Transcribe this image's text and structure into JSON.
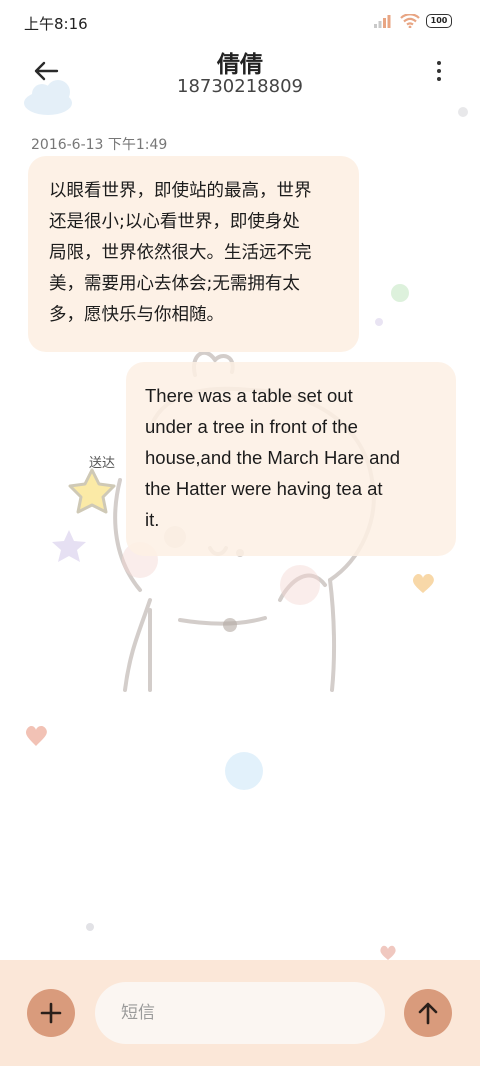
{
  "status_bar": {
    "time": "上午8:16",
    "battery": "100",
    "icons": [
      "signal-icon",
      "wifi-icon",
      "battery-icon"
    ]
  },
  "header": {
    "title": "倩倩",
    "phone": "18730218809",
    "icons": [
      "back-arrow-icon",
      "more-vert-icon"
    ]
  },
  "conversation": {
    "timestamp": "2016-6-13 下午1:49",
    "incoming": {
      "lines": [
        "以眼看世界，即使站的最高，世界",
        "还是很小;以心看世界，即使身处",
        "局限，世界依然很大。生活远不完",
        "美，需要用心去体会;无需拥有太",
        "多，愿快乐与你相随。"
      ]
    },
    "outgoing": {
      "lines": [
        "There was a table set out",
        "under a tree in front of the",
        "house,and the March Hare and",
        "the Hatter were having tea at",
        "it."
      ],
      "status": "送达"
    }
  },
  "composer": {
    "placeholder": "短信",
    "icons": [
      "plus-icon",
      "send-arrow-up-icon"
    ]
  },
  "colors": {
    "bubble": "#fdf1e6",
    "composer_bg": "#fbe7d8",
    "accent": "#d99b7c"
  }
}
